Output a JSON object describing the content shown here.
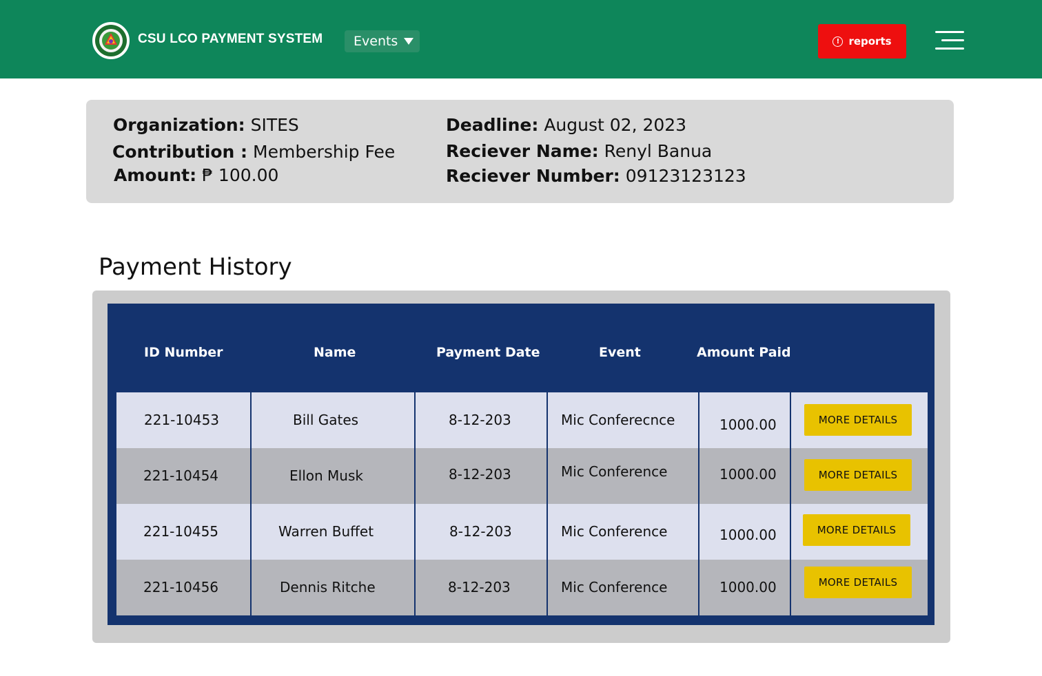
{
  "header": {
    "app_title": "CSU LCO PAYMENT SYSTEM",
    "events_dropdown": "Events",
    "reports_label": "reports",
    "alert_glyph": "!",
    "colors": {
      "bar": "#0e865a",
      "reports": "#ee0f0f"
    },
    "icons": {
      "logo": "university-seal-logo",
      "menu": "hamburger-menu-icon",
      "alert": "alert-circle-icon",
      "dropdown": "caret-down-icon"
    }
  },
  "info": {
    "organization_label": "Organization:",
    "organization_value": "SITES",
    "contribution_label": "Contribution :",
    "contribution_value": "Membership Fee",
    "amount_label": "Amount:",
    "amount_value": "₱ 100.00",
    "deadline_label": "Deadline:",
    "deadline_value": "August 02, 2023",
    "receiver_name_label": "Reciever Name:",
    "receiver_name_value": "Renyl Banua",
    "receiver_number_label": "Reciever Number:",
    "receiver_number_value": "09123123123"
  },
  "payment_history": {
    "title": "Payment History",
    "columns": [
      "ID Number",
      "Name",
      "Payment Date",
      "Event",
      "Amount Paid"
    ],
    "rows": [
      {
        "id": "221-10453",
        "name": "Bill Gates",
        "date": "8-12-203",
        "event": "Mic Conferecnce",
        "amount": "1000.00",
        "action": "MORE DETAILS"
      },
      {
        "id": "221-10454",
        "name": "Ellon Musk",
        "date": "8-12-203",
        "event": "Mic Conference",
        "amount": "1000.00",
        "action": "MORE DETAILS"
      },
      {
        "id": "221-10455",
        "name": "Warren Buffet",
        "date": "8-12-203",
        "event": "Mic Conference",
        "amount": "1000.00",
        "action": "MORE DETAILS"
      },
      {
        "id": "221-10456",
        "name": "Dennis Ritche",
        "date": "8-12-203",
        "event": "Mic Conference",
        "amount": "1000.00",
        "action": "MORE DETAILS"
      }
    ],
    "colors": {
      "table": "#14336e",
      "row_light": "#dde0ee",
      "row_dark": "#b5b6bb",
      "button": "#e8c200"
    }
  }
}
